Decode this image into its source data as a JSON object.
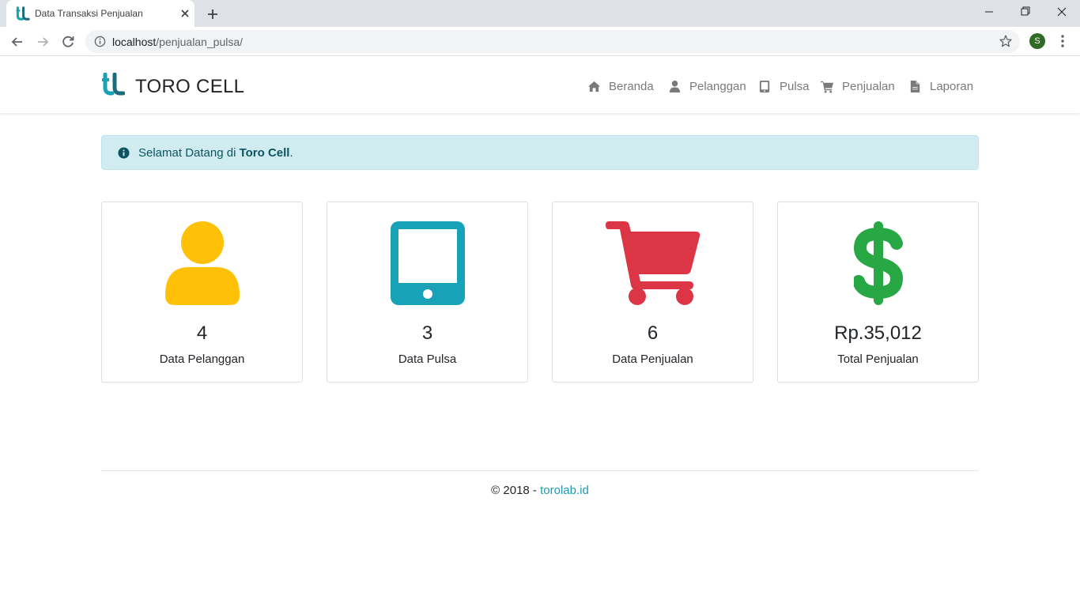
{
  "browser": {
    "tab_title": "Data Transaksi Penjualan",
    "url_host": "localhost",
    "url_path": "/penjualan_pulsa/",
    "profile_initial": "S"
  },
  "navbar": {
    "brand": "TORO CELL",
    "items": [
      {
        "label": "Beranda",
        "icon": "home-icon"
      },
      {
        "label": "Pelanggan",
        "icon": "user-icon"
      },
      {
        "label": "Pulsa",
        "icon": "tablet-icon"
      },
      {
        "label": "Penjualan",
        "icon": "cart-icon"
      },
      {
        "label": "Laporan",
        "icon": "file-icon"
      }
    ]
  },
  "alert": {
    "prefix": "Selamat Datang di ",
    "bold": "Toro Cell",
    "suffix": "."
  },
  "cards": [
    {
      "value": "4",
      "label": "Data Pelanggan",
      "icon": "user-icon",
      "color": "#ffc107"
    },
    {
      "value": "3",
      "label": "Data Pulsa",
      "icon": "tablet-icon",
      "color": "#17a2b8"
    },
    {
      "value": "6",
      "label": "Data Penjualan",
      "icon": "cart-icon",
      "color": "#dc3545"
    },
    {
      "value": "Rp.35,012",
      "label": "Total Penjualan",
      "icon": "dollar-icon",
      "color": "#28a745"
    }
  ],
  "footer": {
    "prefix": "© 2018 - ",
    "link": "torolab.id"
  },
  "colors": {
    "accent": "#1e9bb0",
    "alert_bg": "#d1ecf1",
    "alert_text": "#0c5460"
  }
}
